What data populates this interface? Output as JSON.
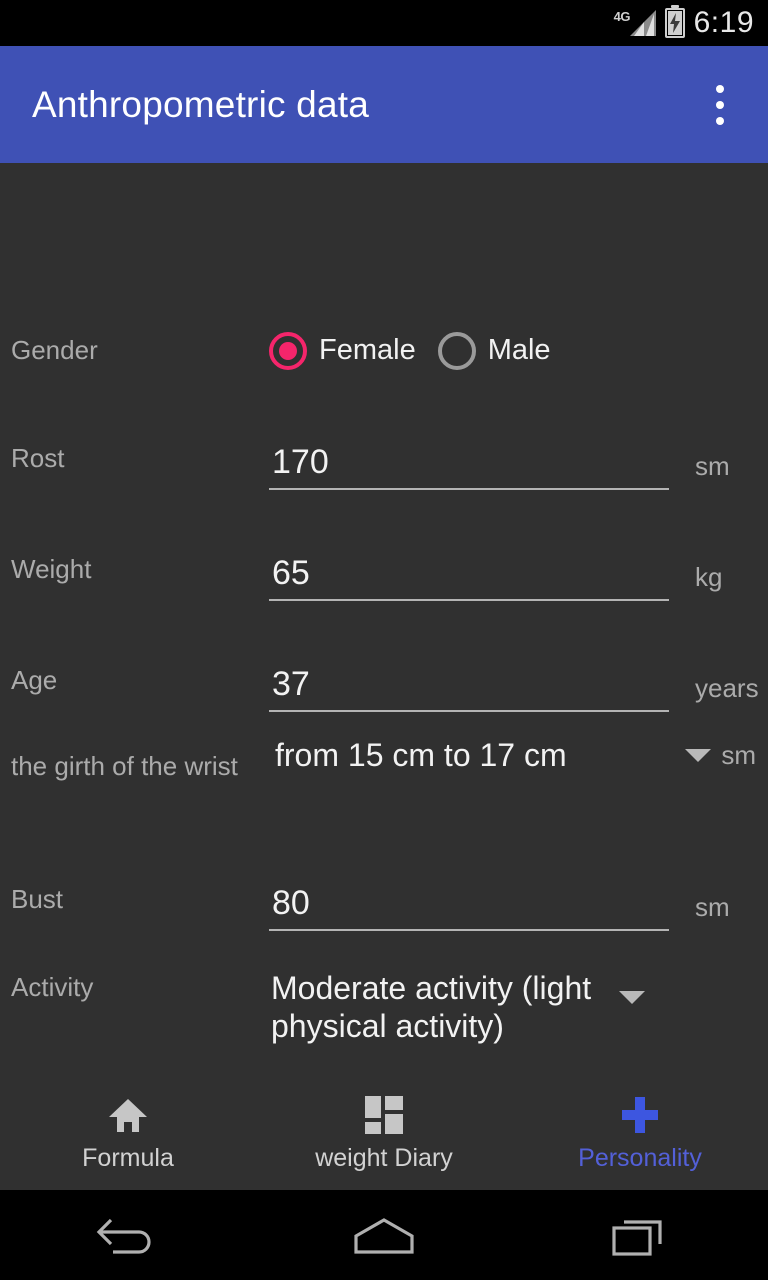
{
  "status_bar": {
    "network": "4G",
    "signal_icon": "signal-bars-icon",
    "battery_icon": "battery-charging-icon",
    "time": "6:19"
  },
  "app_bar": {
    "title": "Anthropometric data",
    "overflow_icon": "more-vert-icon",
    "color": "#3f51b5"
  },
  "theme": {
    "background": "#303030",
    "accent_pink": "#f5256b",
    "accent_blue": "#5360d8",
    "label_color": "#ababab",
    "value_color": "#f2f2f2"
  },
  "form": {
    "gender": {
      "label": "Gender",
      "options": [
        {
          "label": "Female",
          "selected": true
        },
        {
          "label": "Male",
          "selected": false
        }
      ]
    },
    "fields": [
      {
        "label": "Rost",
        "value": "170",
        "unit": "sm"
      },
      {
        "label": "Weight",
        "value": "65",
        "unit": "kg"
      },
      {
        "label": "Age",
        "value": "37",
        "unit": "years"
      }
    ],
    "wrist": {
      "label": "the girth of the wrist",
      "value": "from 15 cm to 17 cm",
      "unit": "sm",
      "caret_icon": "chevron-down-icon"
    },
    "bust": {
      "label": "Bust",
      "value": "80",
      "unit": "sm"
    },
    "activity": {
      "label": "Activity",
      "value": "Moderate activity (light physical activity)",
      "caret_icon": "chevron-down-icon"
    }
  },
  "tabs": [
    {
      "label": "Formula",
      "icon": "home-icon",
      "active": false
    },
    {
      "label": "weight Diary",
      "icon": "dashboard-icon",
      "active": false
    },
    {
      "label": "Personality",
      "icon": "plus-icon",
      "active": true
    }
  ],
  "system_nav": {
    "back": "back-icon",
    "home": "home-icon",
    "recents": "recents-icon"
  }
}
